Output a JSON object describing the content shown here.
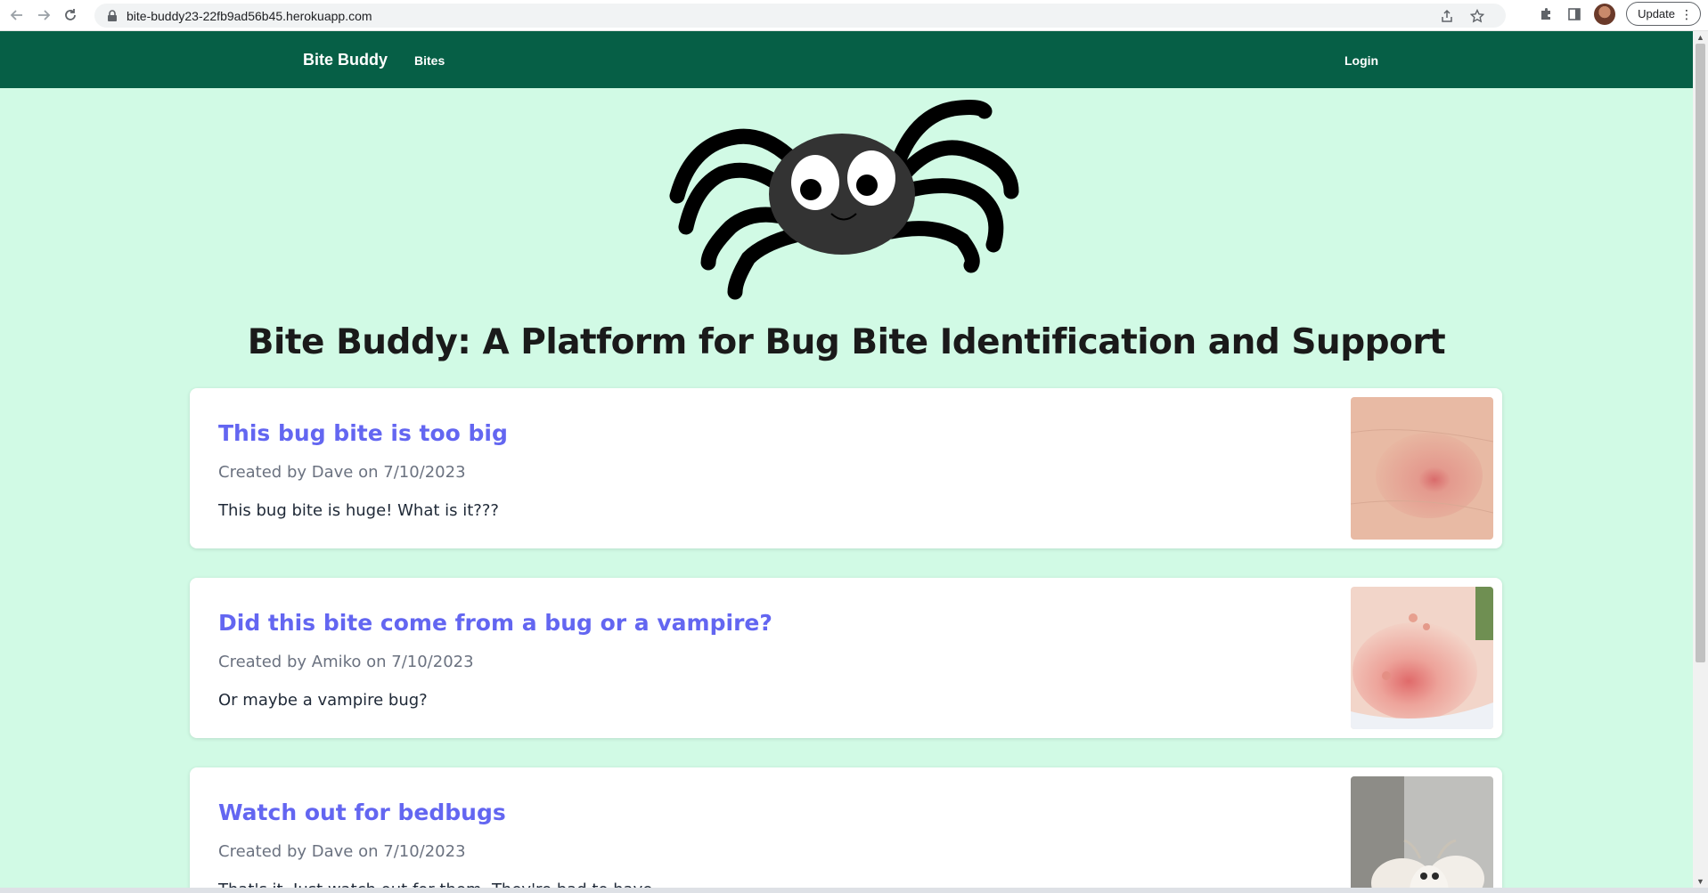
{
  "browser": {
    "url": "bite-buddy23-22fb9ad56b45.herokuapp.com",
    "update_label": "Update",
    "back_icon": "arrow-left-icon",
    "forward_icon": "arrow-right-icon",
    "reload_icon": "reload-icon"
  },
  "navbar": {
    "brand": "Bite Buddy",
    "bites_link": "Bites",
    "login_link": "Login",
    "color": "#065f46"
  },
  "page": {
    "heading": "Bite Buddy: A Platform for Bug Bite Identification and Support",
    "background": "#d1fae5",
    "link_color": "#6366f1"
  },
  "posts": [
    {
      "title": "This bug bite is too big",
      "meta": "Created by Dave on 7/10/2023",
      "body": "This bug bite is huge! What is it???",
      "image": "skin-bite-photo"
    },
    {
      "title": "Did this bite come from a bug or a vampire?",
      "meta": "Created by Amiko on 7/10/2023",
      "body": "Or maybe a vampire bug?",
      "image": "neck-bite-photo"
    },
    {
      "title": "Watch out for bedbugs",
      "meta": "Created by Dave on 7/10/2023",
      "body": "That's it. Just watch out for them. They're bad to have.",
      "image": "moth-photo"
    }
  ]
}
